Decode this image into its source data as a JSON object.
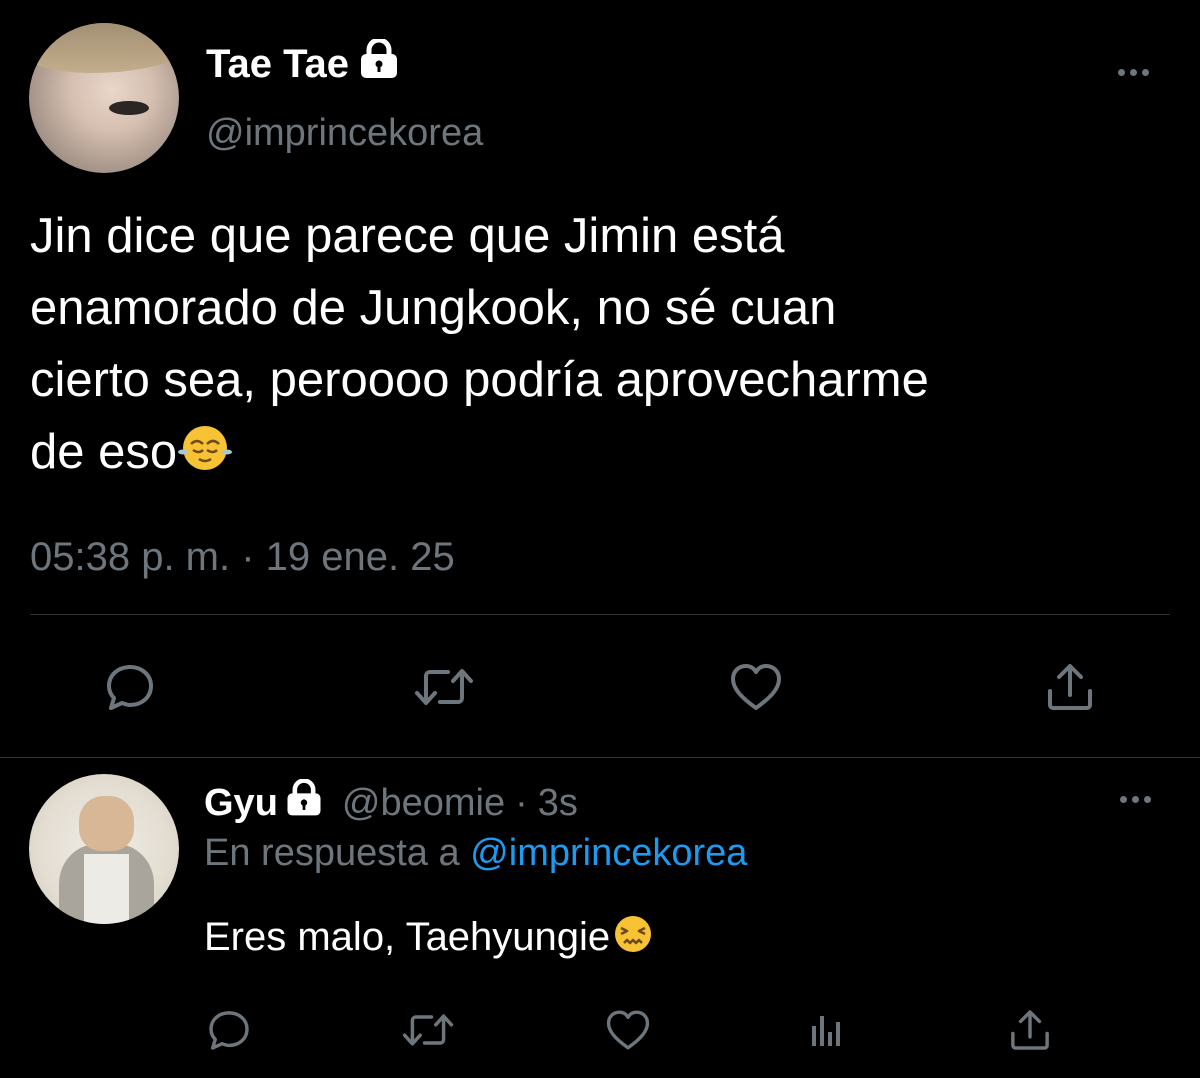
{
  "main_tweet": {
    "display_name": "Tae Tae",
    "handle": "@imprincekorea",
    "text_lines": [
      "Jin dice que parece que Jimin está",
      "enamorado de Jungkook, no sé cuan",
      "cierto sea, peroooo podría aprovecharme",
      "de eso"
    ],
    "emoji": "relieved-face-emoji",
    "timestamp": "05:38 p. m. · 19 ene. 25",
    "actions": [
      "reply-icon",
      "retweet-icon",
      "like-icon",
      "share-icon"
    ]
  },
  "reply": {
    "display_name": "Gyu",
    "handle": "@beomie",
    "dot": "·",
    "time": "3s",
    "reply_prefix": "En respuesta a",
    "reply_mention": "@imprincekorea",
    "text": "Eres malo, Taehyungie",
    "emoji": "confounded-face-emoji",
    "actions": [
      "reply-icon",
      "retweet-icon",
      "like-icon",
      "analytics-icon",
      "share-icon"
    ]
  },
  "colors": {
    "background": "#000000",
    "text_primary": "#ffffff",
    "text_secondary": "#6e767d",
    "link": "#1d9bf0",
    "divider": "#2f3336"
  }
}
